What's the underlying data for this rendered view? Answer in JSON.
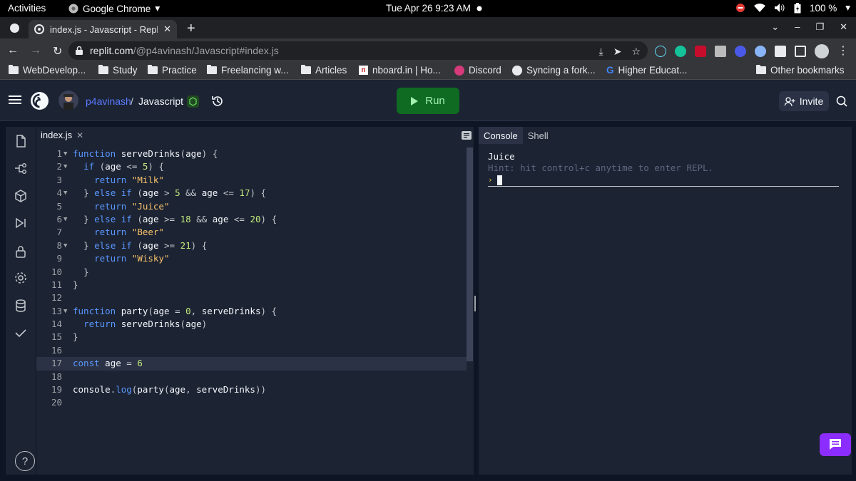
{
  "os_bar": {
    "activities": "Activities",
    "app_name": "Google Chrome",
    "datetime": "Tue Apr 26  9:23 AM",
    "battery": "100 %"
  },
  "browser": {
    "tab_title": "index.js - Javascript - Repl",
    "url_host": "replit.com",
    "url_path": "/@p4avinash/Javascript#index.js",
    "bookmarks": [
      "WebDevelop...",
      "Study",
      "Practice",
      "Freelancing w...",
      "Articles",
      "nboard.in | Ho...",
      "Discord",
      "Syncing a fork...",
      "Higher Educat..."
    ],
    "other_bookmarks": "Other bookmarks"
  },
  "replit": {
    "username": "p4avinash",
    "separator": "/",
    "repl_name": "Javascript",
    "run_label": "Run",
    "invite_label": "Invite",
    "editor_tab": "index.js",
    "console_tabs": [
      "Console",
      "Shell"
    ],
    "console_output": "Juice",
    "console_hint": "Hint: hit control+c anytime to enter REPL.",
    "help_label": "?",
    "colors": {
      "run_bg": "#0f6a22",
      "accent": "#8c2dff",
      "bg": "#0e1525",
      "surface": "#1c2333"
    }
  },
  "code_lines": [
    "function serveDrinks(age) {",
    "  if (age <= 5) {",
    "    return \"Milk\"",
    "  } else if (age > 5 && age <= 17) {",
    "    return \"Juice\"",
    "  } else if (age >= 18 && age <= 20) {",
    "    return \"Beer\"",
    "  } else if (age >= 21) {",
    "    return \"Wisky\"",
    "  }",
    "}",
    "",
    "function party(age = 0, serveDrinks) {",
    "  return serveDrinks(age)",
    "}",
    "",
    "const age = 6",
    "",
    "console.log(party(age, serveDrinks))",
    ""
  ],
  "editor_state": {
    "active_line": 17,
    "folded_lines": [
      1,
      2,
      4,
      6,
      8,
      13
    ]
  }
}
